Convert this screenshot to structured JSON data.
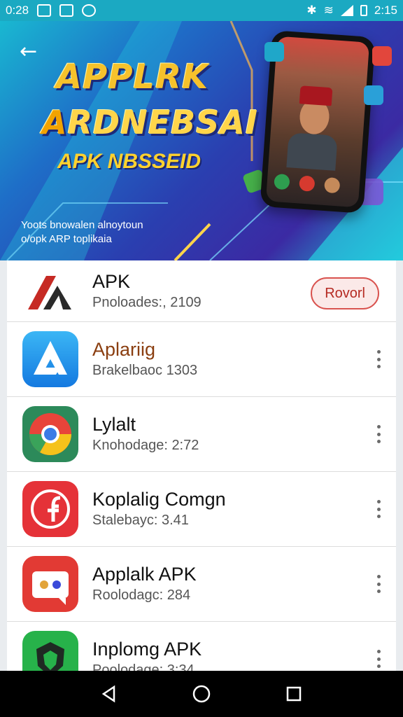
{
  "status_bar": {
    "time": "0:28",
    "battery_text": "2:15"
  },
  "banner": {
    "title_line1": "APPLRK",
    "title_line2_prefix": "A",
    "title_line2_rest": "RDNEBSAI",
    "tagline": "APK NBSSEID",
    "subtext_line1": "Yoots bnowalen alnoytoun",
    "subtext_line2": "o/opk ARP toplikaia"
  },
  "apps": [
    {
      "name": "APK",
      "subtitle": "Pnoloades:, 2109",
      "action_label": "Rovorl",
      "icon": "apk-logo-icon",
      "name_color": "#111111"
    },
    {
      "name": "Aplariig",
      "subtitle": "Brakelbaoc 1303",
      "icon": "store-arrow-icon",
      "name_color": "#8a3e10"
    },
    {
      "name": "Lylalt",
      "subtitle": "Knohodage: 2:72",
      "icon": "chrome-like-icon",
      "name_color": "#111111"
    },
    {
      "name": "Koplalig Comgn",
      "subtitle": "Stalebayc: 3.41",
      "icon": "f-logo-icon",
      "name_color": "#111111"
    },
    {
      "name": "Applalk APK",
      "subtitle": "Roolodagc: 284",
      "icon": "face-box-icon",
      "name_color": "#111111"
    },
    {
      "name": "Inplomg APK",
      "subtitle": "Poolodage: 3:34",
      "icon": "green-shield-icon",
      "name_color": "#111111"
    }
  ],
  "colors": {
    "status_bar": "#1ba9c2",
    "accent_red": "#d9534f",
    "list_bg": "#ffffff",
    "nav_bg": "#000000"
  }
}
